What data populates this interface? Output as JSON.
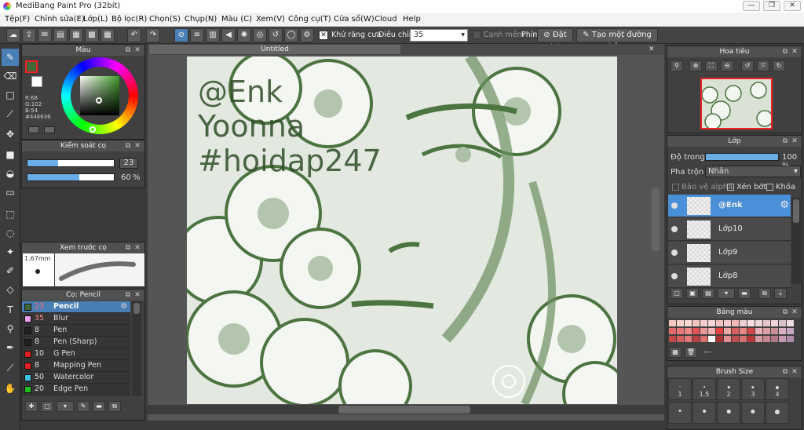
{
  "window": {
    "title": "MediBang Paint Pro (32bit)",
    "min": "—",
    "max": "❐",
    "close": "✕"
  },
  "menu": [
    "Tệp(F)",
    "Chỉnh sửa(E)",
    "Lớp(L)",
    "Bộ lọc(R)",
    "Chọn(S)",
    "Chụp(N)",
    "Màu (C)",
    "Xem(V)",
    "Công cụ(T)",
    "Cửa sổ(W)",
    "Cloud",
    "Help"
  ],
  "toolbar": {
    "antialias": "Khử răng cưa",
    "adjust_label": "Điều chỉnh",
    "adjust_value": "35",
    "canh_mem": "Cạnh mềm",
    "phim": "Phím",
    "reset": "Đặt lại",
    "make_line": "Tạo một đường thẳng"
  },
  "color_panel": {
    "title": "Màu",
    "r": "R:68",
    "g": "G:102",
    "b": "B:54",
    "hex": "#446636",
    "main_color": "#446636"
  },
  "brush_control": {
    "title": "Kiểm soát cọ",
    "size_value": "23",
    "opacity_value": "60",
    "opacity_unit": "%",
    "size_fraction": 0.35,
    "opacity_fraction": 0.6
  },
  "preview": {
    "title": "Xem trước cọ",
    "size": "1.67mm"
  },
  "brushes": {
    "title": "Cọ: Pencil",
    "items": [
      {
        "size": "23",
        "name": "Pencil",
        "color": "#446636",
        "selected": true
      },
      {
        "size": "35",
        "name": "Blur",
        "color": "#f0a0f0"
      },
      {
        "size": "8",
        "name": "Pen",
        "color": "#222222"
      },
      {
        "size": "8",
        "name": "Pen (Sharp)",
        "color": "#222222"
      },
      {
        "size": "10",
        "name": "G Pen",
        "color": "#e02020"
      },
      {
        "size": "8",
        "name": "Mapping Pen",
        "color": "#e02020"
      },
      {
        "size": "50",
        "name": "Watercolor",
        "color": "#40c0e0"
      },
      {
        "size": "20",
        "name": "Edge Pen",
        "color": "#20c020"
      }
    ]
  },
  "canvas": {
    "tab": "Untitled",
    "text_lines": [
      "@Enk",
      "Yoonna",
      "#hoidap247"
    ]
  },
  "navigator": {
    "title": "Hoa tiêu"
  },
  "layers": {
    "title": "Lớp",
    "opacity_label": "Độ trong",
    "opacity_value": "100 %",
    "opacity_fraction": 1.0,
    "blend_label": "Pha trộn",
    "blend_value": "Nhân",
    "protect_alpha": "Bảo vệ alpha",
    "clipping": "Xén bớt",
    "lock": "Khóa",
    "items": [
      {
        "name": "@Enk",
        "selected": true
      },
      {
        "name": "Lớp10"
      },
      {
        "name": "Lớp9"
      },
      {
        "name": "Lớp8"
      }
    ]
  },
  "palette": {
    "title": "Bảng màu",
    "extra": "---",
    "colors": [
      "#f7c9c2",
      "#f8d2cb",
      "#f9dad4",
      "#f2c4c0",
      "#f5cdd0",
      "#f8d6d9",
      "#f5c0c0",
      "#f8cad0",
      "#f3b7b4",
      "#f0d0d4",
      "#f8e0e0",
      "#ecd8d8",
      "#e8c8cc",
      "#f4d4d8",
      "#d8c4cc",
      "#ecdce4",
      "#e26b6b",
      "#e87a7a",
      "#ee8a8a",
      "#e05555",
      "#ec9898",
      "#f4b2b2",
      "#e04040",
      "#f2a6a6",
      "#d86060",
      "#e88888",
      "#d04848",
      "#eab0b8",
      "#dca0a8",
      "#c89098",
      "#d8b0c0",
      "#c8a8c0",
      "#c44a4a",
      "#d46060",
      "#e07a7a",
      "#b84040",
      "#d87070",
      "#ffffff",
      "#a83030",
      "#e49090",
      "#c05050",
      "#d47070",
      "#b83838",
      "#d49aa4",
      "#c88894",
      "#b07888",
      "#c89cb4",
      "#b08ca8"
    ]
  },
  "brush_size": {
    "title": "Brush Size",
    "labels": [
      "1",
      "1.5",
      "2",
      "3",
      "4"
    ]
  }
}
